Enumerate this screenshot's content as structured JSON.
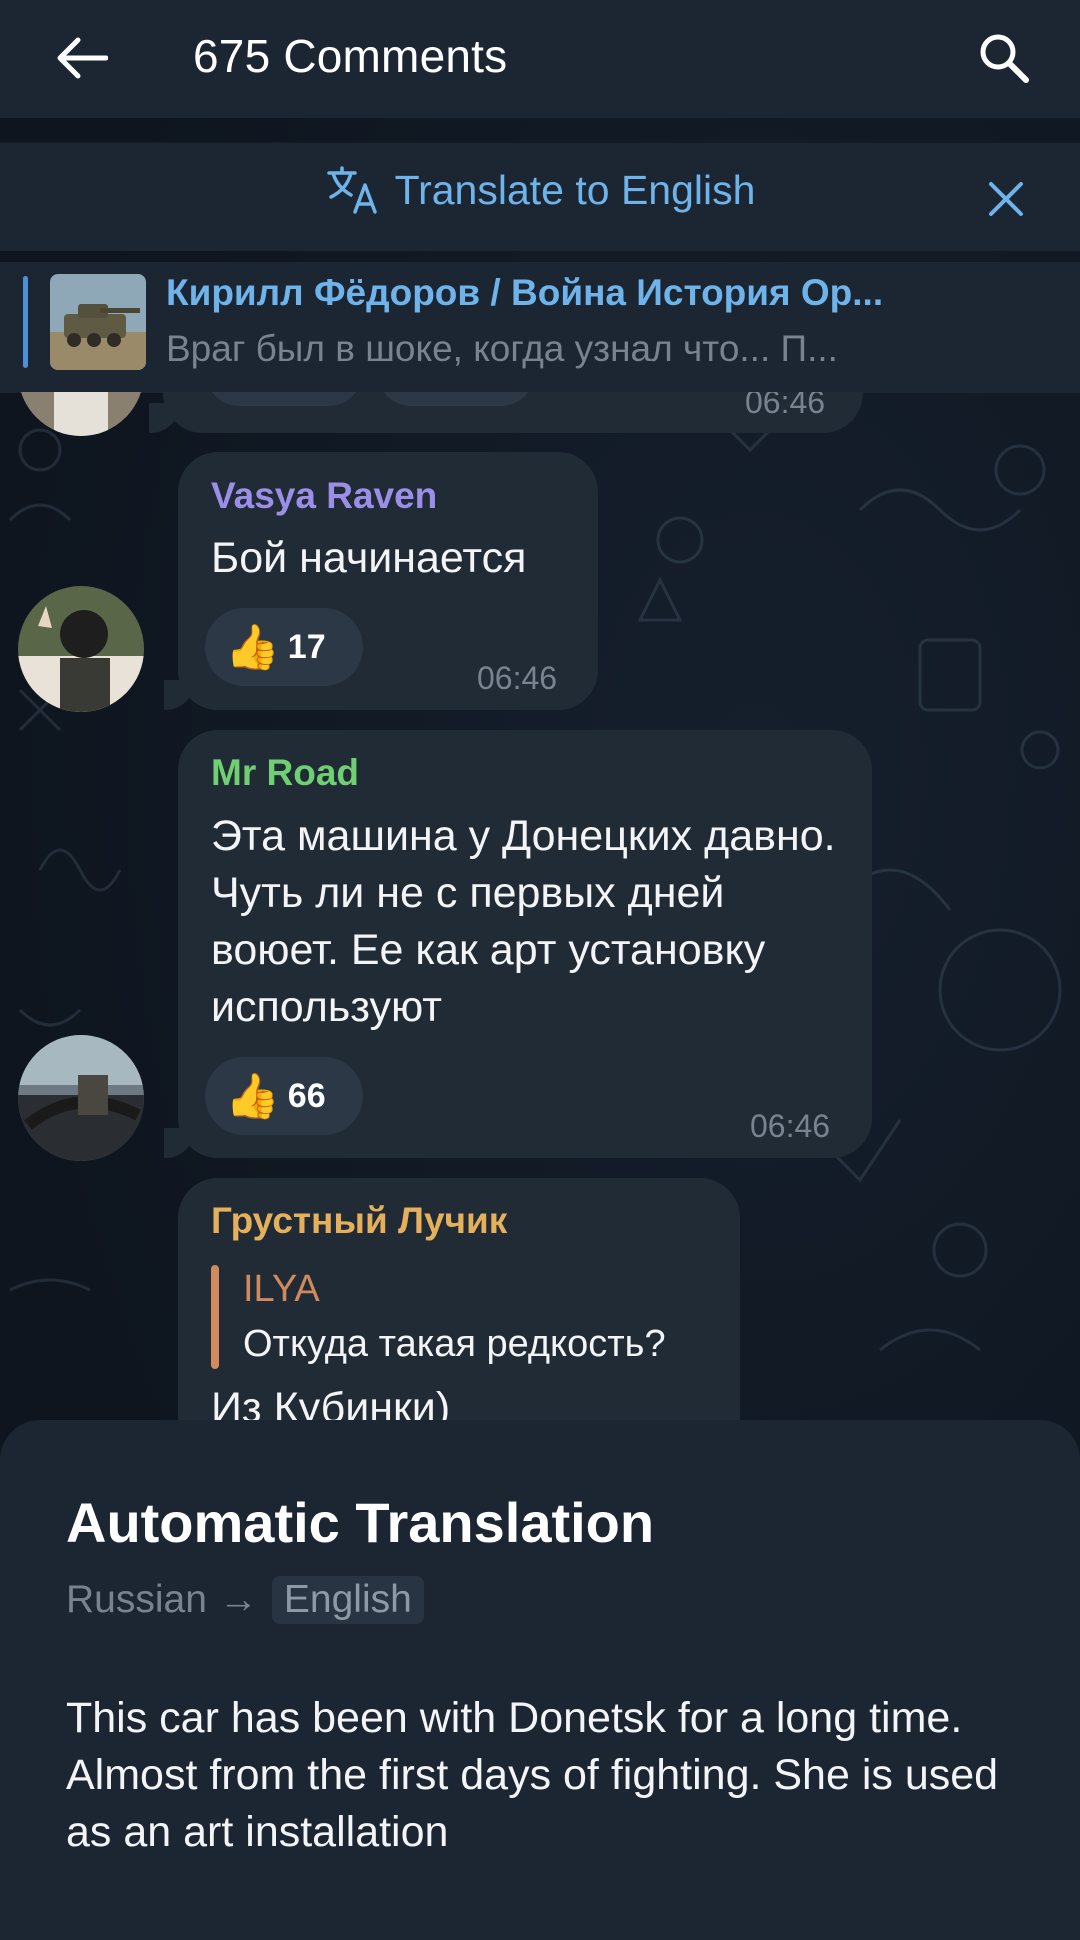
{
  "header": {
    "title": "675 Comments"
  },
  "translate_bar": {
    "label": "Translate to English"
  },
  "pinned": {
    "title": "Кирилл Фёдоров / Война История Ор...",
    "text": "Враг был в шоке, когда узнал что...   П..."
  },
  "messages": [
    {
      "time": "06:46"
    },
    {
      "sender": "Vasya Raven",
      "sender_color": "#9b8ee8",
      "text": "Бой начинается",
      "reaction": {
        "emoji": "👍",
        "count": "17"
      },
      "time": "06:46"
    },
    {
      "sender": "Mr Road",
      "sender_color": "#6fcf72",
      "text": "Эта машина у Донецких давно. Чуть ли не с первых дней воюет. Ее как арт установку используют",
      "reaction": {
        "emoji": "👍",
        "count": "66"
      },
      "time": "06:46"
    },
    {
      "sender": "Грустный Лучик",
      "sender_color": "#e5b05c",
      "reply": {
        "author": "ILYA",
        "text": "Откуда такая редкость?"
      },
      "text": "Из Кубинки)"
    }
  ],
  "sheet": {
    "title": "Automatic Translation",
    "from_lang": "Russian",
    "arrow": "→",
    "to_lang": "English",
    "translation": "This car has been with Donetsk for a long time. Almost from the first days of fighting. She is used as an art installation"
  },
  "colors": {
    "accent": "#6eb3ea",
    "bubble": "#212b36",
    "header": "#1c2633"
  }
}
